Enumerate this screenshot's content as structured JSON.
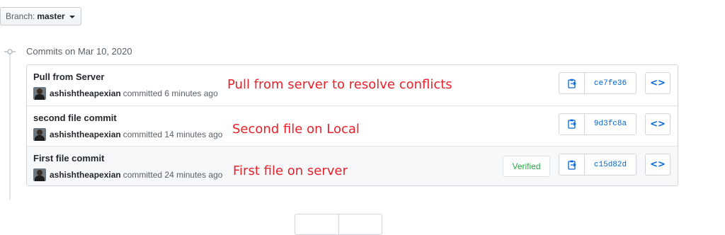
{
  "branch": {
    "label": "Branch:",
    "value": "master"
  },
  "group": {
    "title": "Commits on Mar 10, 2020"
  },
  "commits": [
    {
      "message": "Pull from Server",
      "author": "ashishtheapexian",
      "time": "committed 6 minutes ago",
      "annotation": "Pull from server to resolve conflicts",
      "sha": "ce7fe36",
      "verified": ""
    },
    {
      "message": "second file commit",
      "author": "ashishtheapexian",
      "time": "committed 14 minutes ago",
      "annotation": "Second file on Local",
      "sha": "9d3fc8a",
      "verified": ""
    },
    {
      "message": "First file commit",
      "author": "ashishtheapexian",
      "time": "committed 24 minutes ago",
      "annotation": "First file on server",
      "sha": "c15d82d",
      "verified": "Verified"
    }
  ],
  "icons": {
    "copy": "clipboard-icon",
    "browse": "code-icon",
    "commit": "git-commit-icon"
  },
  "colors": {
    "annotation": "#e8212a",
    "link": "#0366d6",
    "verified": "#28a745"
  }
}
